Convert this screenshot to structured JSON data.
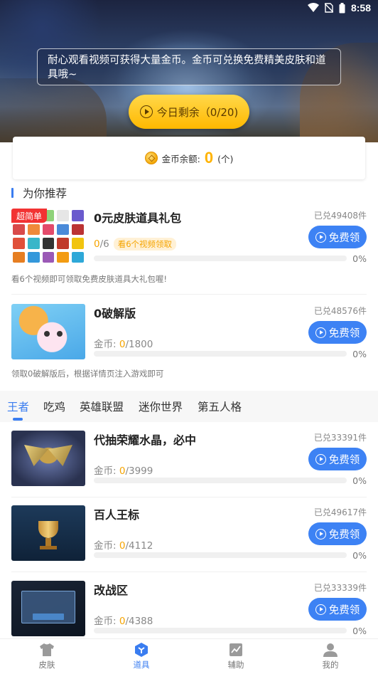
{
  "status_bar": {
    "time": "8:58"
  },
  "hero": {
    "notice": "耐心观看视频可获得大量金币。金币可兑换免费精美皮肤和道具哦~",
    "today_button": "今日剩余（0/20)"
  },
  "balance": {
    "label": "金币余额:",
    "value": "0",
    "unit": "(个)"
  },
  "recommend": {
    "title": "为你推荐",
    "items": [
      {
        "badge": "超简单",
        "name": "0元皮肤道具礼包",
        "sold": "已兑49408件",
        "button": "免费领",
        "progress_current": "0",
        "progress_total": "/6",
        "watch_tag": "看6个视频领取",
        "progress": 0,
        "percent": "0%",
        "desc": "看6个视频即可领取免费皮肤道具大礼包喔!"
      },
      {
        "name": "0破解版",
        "sold": "已兑48576件",
        "button": "免费领",
        "coins_label": "金币: ",
        "coins_current": "0",
        "coins_total": "/1800",
        "progress": 0,
        "percent": "0%",
        "desc": "领取0破解版后，根据详情页注入游戏即可"
      }
    ]
  },
  "tabs": [
    "王者",
    "吃鸡",
    "英雄联盟",
    "迷你世界",
    "第五人格"
  ],
  "active_tab": "王者",
  "list": [
    {
      "name": "代抽荣耀水晶，必中",
      "sold": "已兑33391件",
      "button": "免费领",
      "coins_label": "金币: ",
      "coins_current": "0",
      "coins_total": "/3999",
      "progress": 0,
      "percent": "0%"
    },
    {
      "name": "百人王标",
      "sold": "已兑49617件",
      "button": "免费领",
      "coins_label": "金币: ",
      "coins_current": "0",
      "coins_total": "/4112",
      "progress": 0,
      "percent": "0%"
    },
    {
      "name": "改战区",
      "sold": "已兑33339件",
      "button": "免费领",
      "coins_label": "金币: ",
      "coins_current": "0",
      "coins_total": "/4388",
      "progress": 0,
      "percent": "0%"
    }
  ],
  "bottom_nav": [
    {
      "label": "皮肤",
      "icon": "shirt-icon"
    },
    {
      "label": "道具",
      "icon": "cube-icon"
    },
    {
      "label": "辅助",
      "icon": "chart-icon"
    },
    {
      "label": "我的",
      "icon": "person-icon"
    }
  ],
  "active_nav": "道具",
  "colors": {
    "accent": "#3a7df0",
    "button": "#3d82f4",
    "coin": "#f5a400",
    "badge": "#f23333",
    "hero_button": "#ffc21a"
  }
}
